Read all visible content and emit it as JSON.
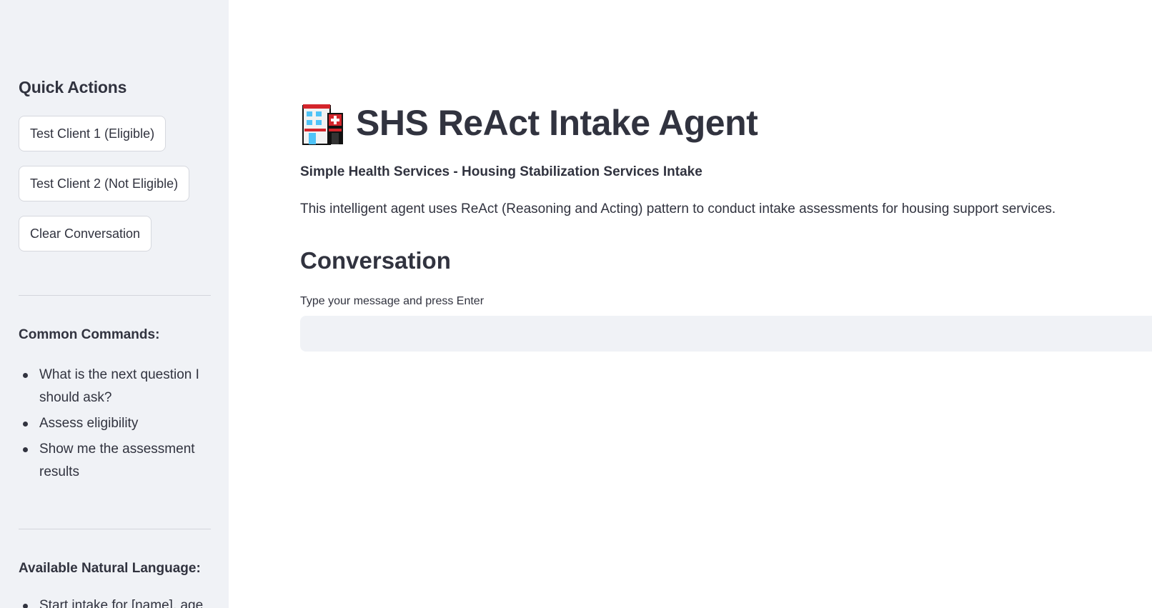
{
  "sidebar": {
    "heading": "Quick Actions",
    "buttons": {
      "test_client_1": "Test Client 1 (Eligible)",
      "test_client_2": "Test Client 2 (Not Eligible)",
      "clear": "Clear Conversation"
    },
    "common_commands": {
      "heading": "Common Commands:",
      "items": [
        "What is the next question I should ask?",
        "Assess eligibility",
        "Show me the assessment results"
      ]
    },
    "natural_language": {
      "heading": "Available Natural Language:",
      "items": [
        "Start intake for [name], age"
      ]
    }
  },
  "main": {
    "title": "SHS ReAct Intake Agent",
    "title_icon": "hospital-icon",
    "subtitle": "Simple Health Services - Housing Stabilization Services Intake",
    "description": "This intelligent agent uses ReAct (Reasoning and Acting) pattern to conduct intake assessments for housing support services.",
    "conversation_heading": "Conversation",
    "input": {
      "label": "Type your message and press Enter",
      "value": "",
      "placeholder": ""
    }
  },
  "colors": {
    "sidebar_bg": "#f0f2f6",
    "text": "#31333f",
    "input_bg": "#f0f2f6",
    "accent": "#ff4b4b"
  }
}
